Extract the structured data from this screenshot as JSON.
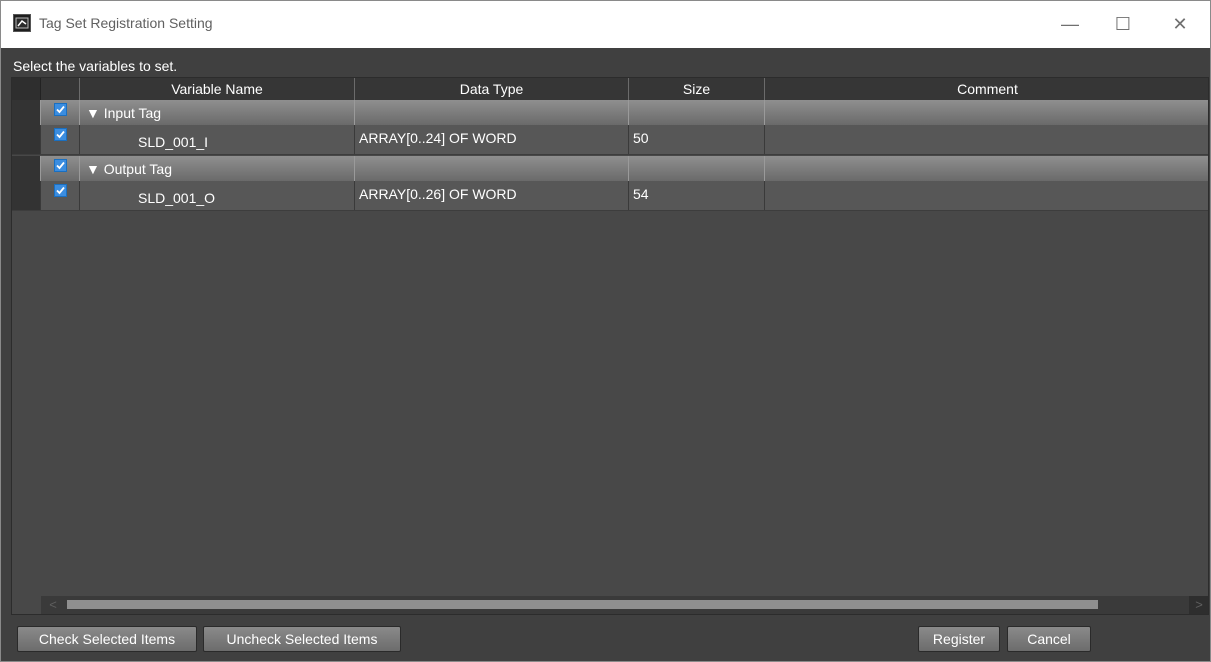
{
  "window": {
    "title": "Tag Set Registration Setting",
    "controls": {
      "minimize": "—",
      "maximize": "☐",
      "close": "✕"
    }
  },
  "instruction": "Select the variables to set.",
  "table": {
    "columns": {
      "name": "Variable Name",
      "type": "Data Type",
      "size": "Size",
      "comment": "Comment"
    },
    "groups": [
      {
        "label": "▼ Input Tag",
        "checked": true,
        "rows": [
          {
            "name": "SLD_001_I",
            "type": "ARRAY[0..24] OF WORD",
            "size": "50",
            "comment": "",
            "checked": true
          }
        ]
      },
      {
        "label": "▼ Output Tag",
        "checked": true,
        "rows": [
          {
            "name": "SLD_001_O",
            "type": "ARRAY[0..26] OF WORD",
            "size": "54",
            "comment": "",
            "checked": true
          }
        ]
      }
    ]
  },
  "scrollbar": {
    "left_arrow": "<",
    "right_arrow": ">"
  },
  "buttons": {
    "check_selected": "Check Selected Items",
    "uncheck_selected": "Uncheck Selected Items",
    "register": "Register",
    "cancel": "Cancel"
  }
}
